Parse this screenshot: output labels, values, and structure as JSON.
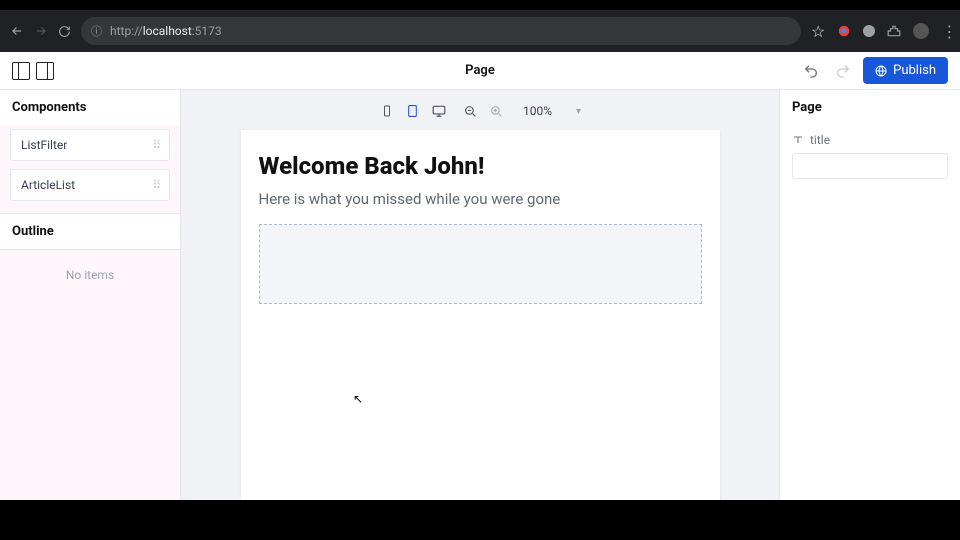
{
  "browser": {
    "url_prefix": "http://",
    "url_host": "localhost",
    "url_port": ":5173"
  },
  "topbar": {
    "title": "Page",
    "publish_label": "Publish"
  },
  "left_panel": {
    "components_header": "Components",
    "items": [
      {
        "label": "ListFilter"
      },
      {
        "label": "ArticleList"
      }
    ],
    "outline_header": "Outline",
    "outline_empty": "No items"
  },
  "canvas": {
    "zoom": "100%",
    "heading": "Welcome Back John!",
    "subheading": "Here is what you missed while you were gone"
  },
  "right_panel": {
    "header": "Page",
    "props": [
      {
        "label": "title"
      }
    ]
  }
}
